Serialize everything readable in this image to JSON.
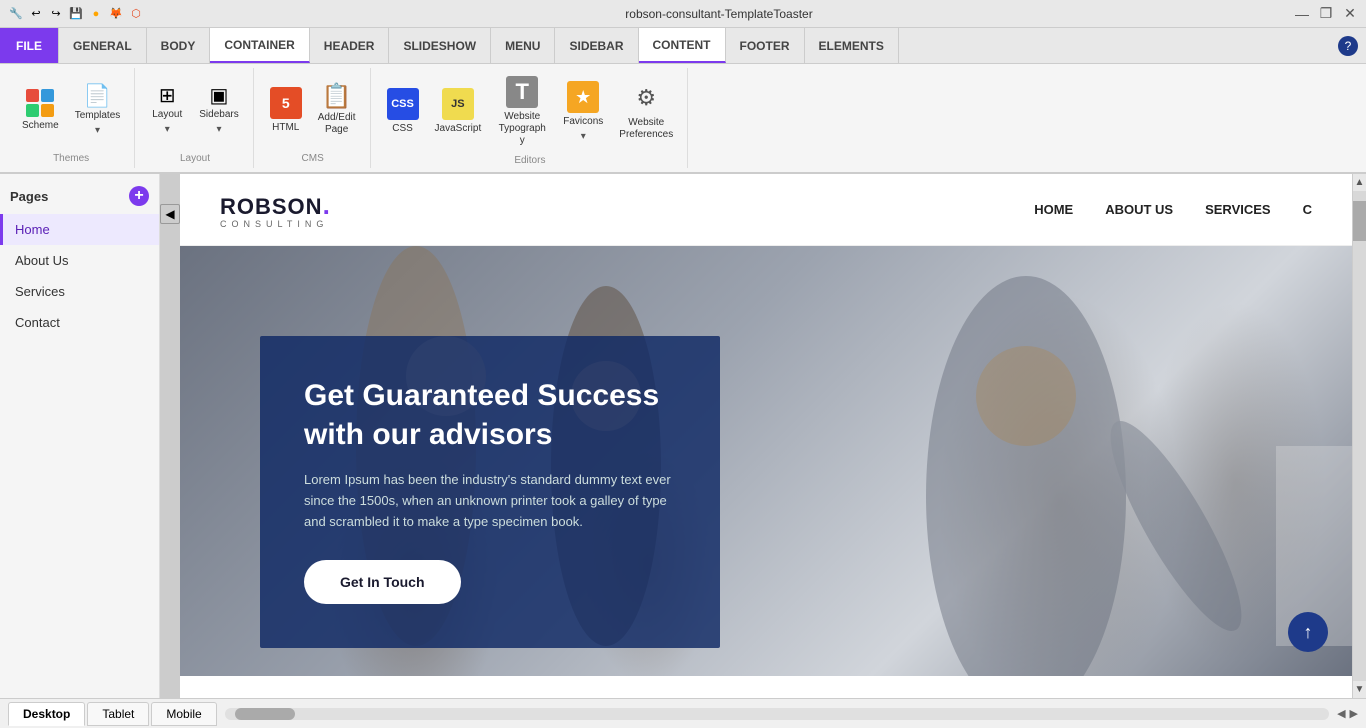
{
  "titlebar": {
    "title": "robson-consultant-TemplateToaster",
    "minimize": "—",
    "restore": "❐",
    "close": "✕"
  },
  "toolbar": {
    "items": [
      "FILE",
      "GENERAL",
      "BODY",
      "CONTAINER",
      "HEADER",
      "SLIDESHOW",
      "MENU",
      "SIDEBAR",
      "CONTENT",
      "FOOTER",
      "ELEMENTS"
    ]
  },
  "ribbon": {
    "groups": [
      {
        "label": "Themes",
        "items": [
          {
            "id": "scheme",
            "label": "Scheme",
            "icon": "grid"
          },
          {
            "id": "templates",
            "label": "Templates",
            "icon": "📄"
          }
        ]
      },
      {
        "label": "Layout",
        "items": [
          {
            "id": "layout",
            "label": "Layout",
            "icon": "⊞"
          },
          {
            "id": "sidebars",
            "label": "Sidebars",
            "icon": "▣"
          }
        ]
      },
      {
        "label": "CMS",
        "items": [
          {
            "id": "html",
            "label": "HTML",
            "icon": "5"
          },
          {
            "id": "add-edit-page",
            "label": "Add/Edit\nPage",
            "icon": "📋"
          }
        ]
      },
      {
        "label": "Editors",
        "items": [
          {
            "id": "css",
            "label": "CSS",
            "icon": "css"
          },
          {
            "id": "javascript",
            "label": "JavaScript",
            "icon": "js"
          },
          {
            "id": "website-typography",
            "label": "Website Typography",
            "icon": "T"
          },
          {
            "id": "favicons",
            "label": "Favicons",
            "icon": "⭐"
          },
          {
            "id": "website-preferences",
            "label": "Website Preferences",
            "icon": "⚙"
          }
        ]
      }
    ]
  },
  "sidebar": {
    "header": "Pages",
    "add_tooltip": "+",
    "items": [
      {
        "id": "home",
        "label": "Home",
        "active": true
      },
      {
        "id": "about-us",
        "label": "About Us",
        "active": false
      },
      {
        "id": "services",
        "label": "Services",
        "active": false
      },
      {
        "id": "contact",
        "label": "Contact",
        "active": false
      }
    ]
  },
  "site": {
    "logo": "ROBSON.",
    "logo_sub": "CONSULTING",
    "logo_dot": ".",
    "nav_links": [
      "HOME",
      "ABOUT US",
      "SERVICES",
      "C"
    ],
    "hero": {
      "title": "Get Guaranteed Success with our advisors",
      "description": "Lorem Ipsum has been the industry's standard dummy text ever since the 1500s, when an unknown printer took a galley of type and scrambled it to make a type specimen book.",
      "cta": "Get In Touch"
    }
  },
  "bottom": {
    "tabs": [
      "Desktop",
      "Tablet",
      "Mobile"
    ]
  },
  "colors": {
    "accent": "#7c3aed",
    "nav_dark": "#1e3a8a"
  }
}
